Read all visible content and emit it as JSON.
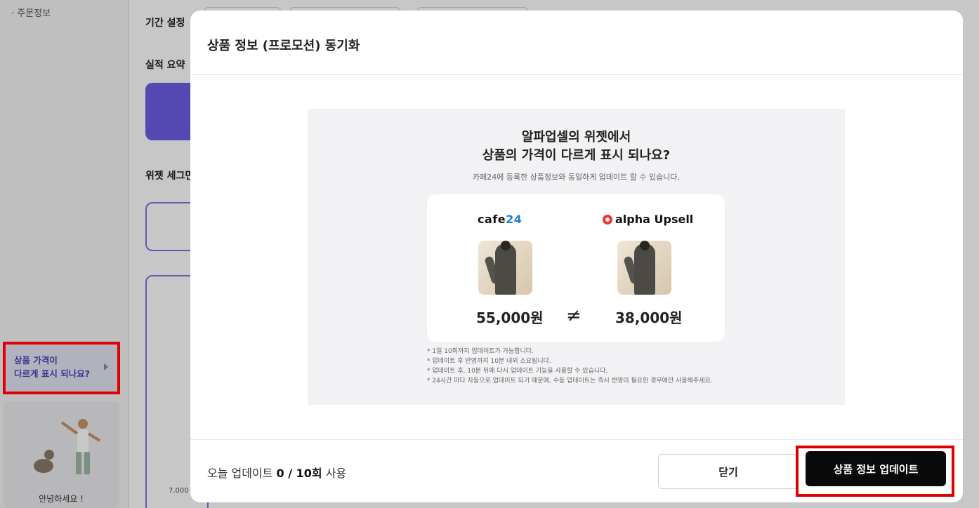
{
  "sidebar": {
    "order_info_label": "주문정보",
    "help_card": {
      "line1": "상품 가격이",
      "line2": "다르게 표시 되나요?"
    },
    "greeting": "안녕하세요 !"
  },
  "background": {
    "period_label": "기간 설정",
    "summary_label": "실적 요약",
    "widget_segment_label": "위젯 세그먼",
    "card_value_partial": "7,000"
  },
  "modal": {
    "title": "상품 정보 (프로모션) 동기화",
    "panel": {
      "title_line1": "알파업셀의 위젯에서",
      "title_line2": "상품의 가격이 다르게 표시 되나요?",
      "subtitle": "카페24에 등록한 상품정보와 동일하게 업데이트 할 수 있습니다.",
      "left_brand_text": "cafe",
      "left_brand_num": "24",
      "right_brand": "alpha Upsell",
      "left_price": "55,000원",
      "right_price": "38,000원",
      "neq_symbol": "≠",
      "notes": [
        "* 1일 10회까지 업데이트가 가능합니다.",
        "* 업데이트 후 반영까지 10분 내외 소요됩니다.",
        "* 업데이트 후, 10분 뒤에 다시 업데이트 기능을 사용할 수 있습니다.",
        "* 24시간 마다 자동으로 업데이트 되기 때문에, 수동 업데이트는 즉시 반영이 필요한 경우에만 사용해주세요."
      ]
    },
    "footer": {
      "usage_prefix": "오늘 업데이트 ",
      "usage_count": "0 / 10회",
      "usage_suffix": " 사용",
      "close_label": "닫기",
      "update_label": "상품 정보 업데이트"
    }
  }
}
